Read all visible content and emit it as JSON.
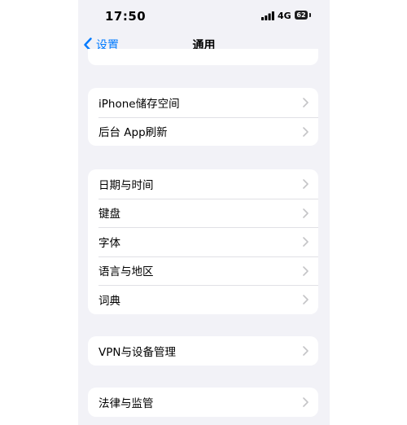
{
  "status_bar": {
    "time": "17:50",
    "network": "4G",
    "battery": "62"
  },
  "nav": {
    "back_label": "设置",
    "title": "通用"
  },
  "groups": [
    {
      "rows": [
        {
          "label": "iPhone储存空间"
        },
        {
          "label": "后台 App刷新"
        }
      ]
    },
    {
      "rows": [
        {
          "label": "日期与时间"
        },
        {
          "label": "键盘"
        },
        {
          "label": "字体"
        },
        {
          "label": "语言与地区"
        },
        {
          "label": "词典"
        }
      ]
    },
    {
      "rows": [
        {
          "label": "VPN与设备管理"
        }
      ]
    },
    {
      "rows": [
        {
          "label": "法律与监管"
        }
      ]
    }
  ],
  "colors": {
    "accent": "#007aff",
    "background": "#f2f2f7",
    "chevron": "#c4c4c7"
  },
  "icons": {
    "back": "chevron-left-icon",
    "row_disclosure": "chevron-right-icon",
    "signal": "cellular-signal-icon",
    "battery": "battery-icon"
  }
}
